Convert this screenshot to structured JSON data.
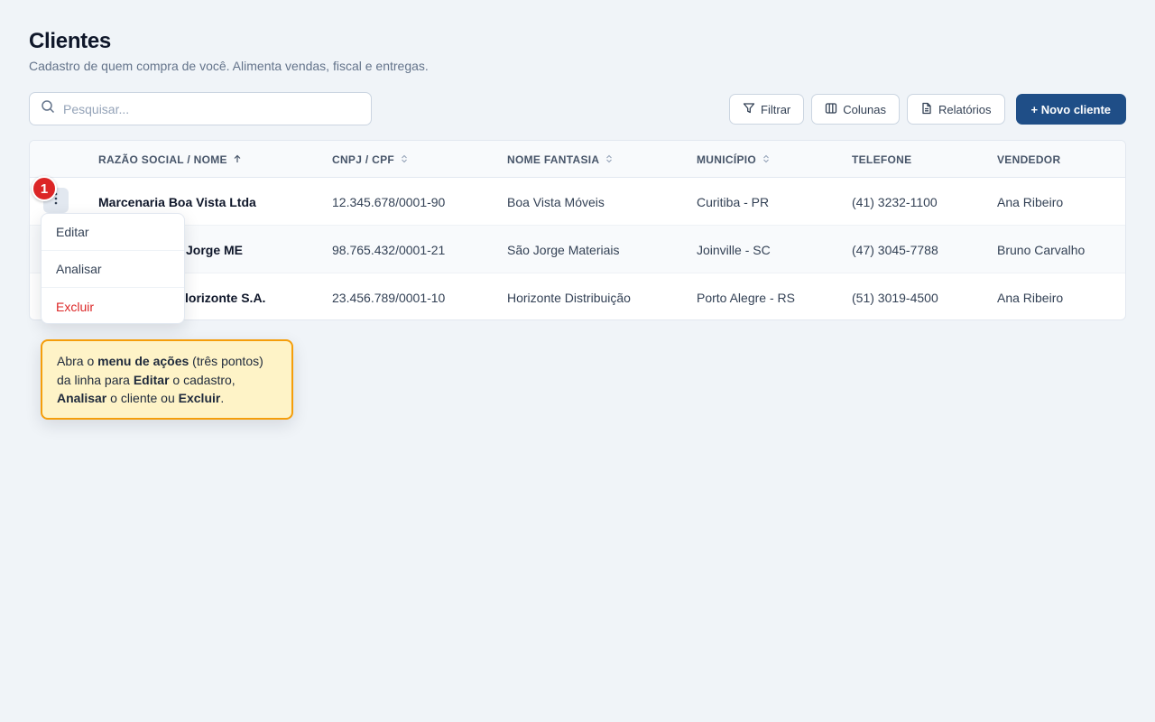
{
  "page": {
    "title": "Clientes",
    "subtitle": "Cadastro de quem compra de você. Alimenta vendas, fiscal e entregas."
  },
  "search": {
    "placeholder": "Pesquisar...",
    "icon": "search-icon"
  },
  "toolbar": {
    "filter_label": "Filtrar",
    "columns_label": "Colunas",
    "reports_label": "Relatórios",
    "new_label": "+ Novo cliente",
    "primary_color": "#1f4e87"
  },
  "table": {
    "headers": {
      "name": "RAZÃO SOCIAL / NOME",
      "cnpj": "CNPJ / CPF",
      "fantasia": "NOME FANTASIA",
      "municipio": "MUNICÍPIO",
      "telefone": "TELEFONE",
      "vendedor": "VENDEDOR"
    },
    "sort": {
      "name": "asc",
      "cnpj": "sortable",
      "fantasia": "sortable",
      "municipio": "sortable"
    },
    "rows": [
      {
        "name": "Marcenaria Boa Vista Ltda",
        "cnpj": "12.345.678/0001-90",
        "fantasia": "Boa Vista Móveis",
        "municipio": "Curitiba - PR",
        "telefone": "(41) 3232-1100",
        "vendedor": "Ana Ribeiro"
      },
      {
        "name": "Jorge ME",
        "cnpj": "98.765.432/0001-21",
        "fantasia": "São Jorge Materiais",
        "municipio": "Joinville - SC",
        "telefone": "(47) 3045-7788",
        "vendedor": "Bruno Carvalho"
      },
      {
        "name": "lorizonte S.A.",
        "cnpj": "23.456.789/0001-10",
        "fantasia": "Horizonte Distribuição",
        "municipio": "Porto Alegre - RS",
        "telefone": "(51) 3019-4500",
        "vendedor": "Ana Ribeiro"
      }
    ]
  },
  "row_actions": {
    "step_number": "1",
    "step_color": "#dc2626",
    "items": [
      "Editar",
      "Analisar",
      "Excluir"
    ]
  },
  "tooltip": {
    "t1": "Abra o ",
    "b1": "menu de ações",
    "t2": " (três pontos) da linha para ",
    "b2": "Editar",
    "t3": " o cadastro, ",
    "b3": "Analisar",
    "t4": " o cliente ou ",
    "b4": "Excluir",
    "t5": "."
  }
}
